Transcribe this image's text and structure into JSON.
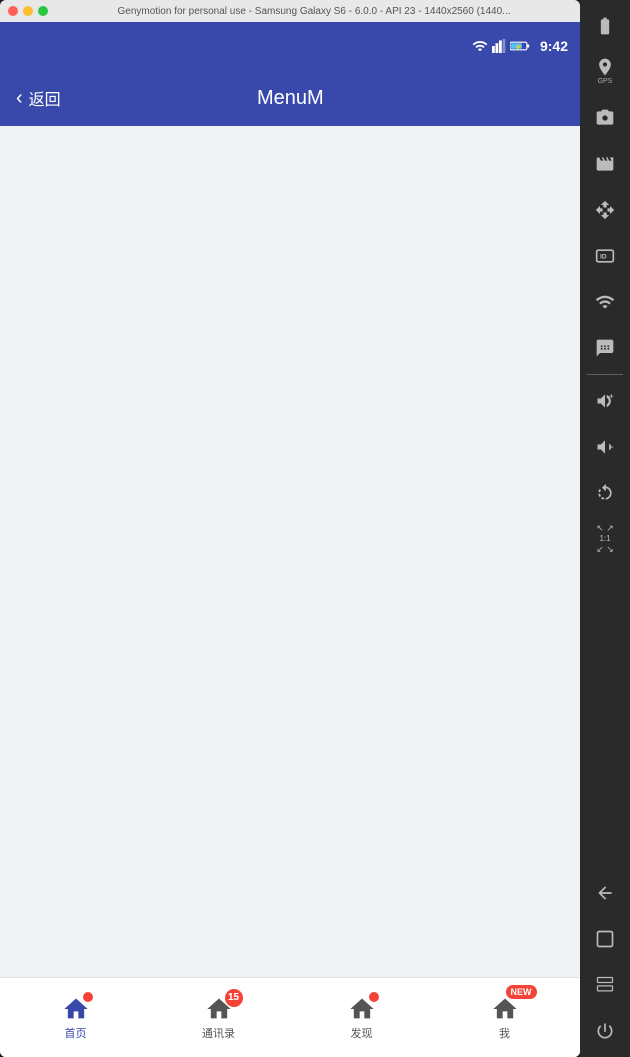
{
  "titleBar": {
    "text": "Genymotion for personal use - Samsung Galaxy S6 - 6.0.0 - API 23 - 1440x2560 (1440..."
  },
  "statusBar": {
    "time": "9:42"
  },
  "appBar": {
    "backLabel": "返回",
    "title": "MenuM"
  },
  "bottomNav": {
    "items": [
      {
        "label": "首页",
        "active": true,
        "badge": "dot"
      },
      {
        "label": "通讯录",
        "active": false,
        "badge": "15"
      },
      {
        "label": "发现",
        "active": false,
        "badge": "dot"
      },
      {
        "label": "我",
        "active": false,
        "badge": "new"
      }
    ]
  },
  "sidebar": {
    "tools": [
      {
        "name": "battery",
        "label": "Battery"
      },
      {
        "name": "gps",
        "label": "GPS"
      },
      {
        "name": "camera",
        "label": "Camera"
      },
      {
        "name": "media",
        "label": "Media"
      },
      {
        "name": "move",
        "label": "Move"
      },
      {
        "name": "id",
        "label": "ID"
      },
      {
        "name": "wifi",
        "label": "WiFi"
      },
      {
        "name": "message",
        "label": "Message"
      },
      {
        "name": "divider",
        "label": ""
      },
      {
        "name": "volume-up",
        "label": "Vol+"
      },
      {
        "name": "volume-down",
        "label": "Vol-"
      },
      {
        "name": "rotate",
        "label": "Rotate"
      },
      {
        "name": "scale",
        "label": "1:1"
      },
      {
        "name": "back-nav",
        "label": "Back"
      },
      {
        "name": "home-nav",
        "label": "Home"
      },
      {
        "name": "app-nav",
        "label": "Apps"
      },
      {
        "name": "power",
        "label": "Power"
      }
    ]
  }
}
